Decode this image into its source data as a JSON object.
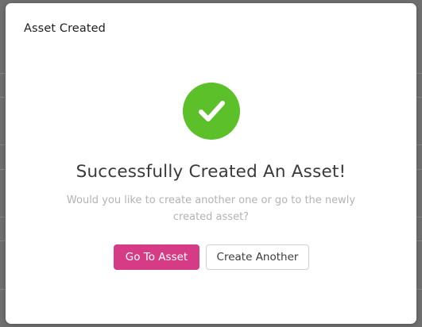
{
  "modal": {
    "title": "Asset Created",
    "headline": "Successfully Created An Asset!",
    "message": "Would you like to create another one or go to the newly created asset?",
    "icon": "check-circle-icon",
    "primary_button_label": "Go To Asset",
    "secondary_button_label": "Create Another"
  },
  "colors": {
    "success": "#5cc02b",
    "primary_button": "#d63c86",
    "overlay": "#6f6f6f"
  }
}
